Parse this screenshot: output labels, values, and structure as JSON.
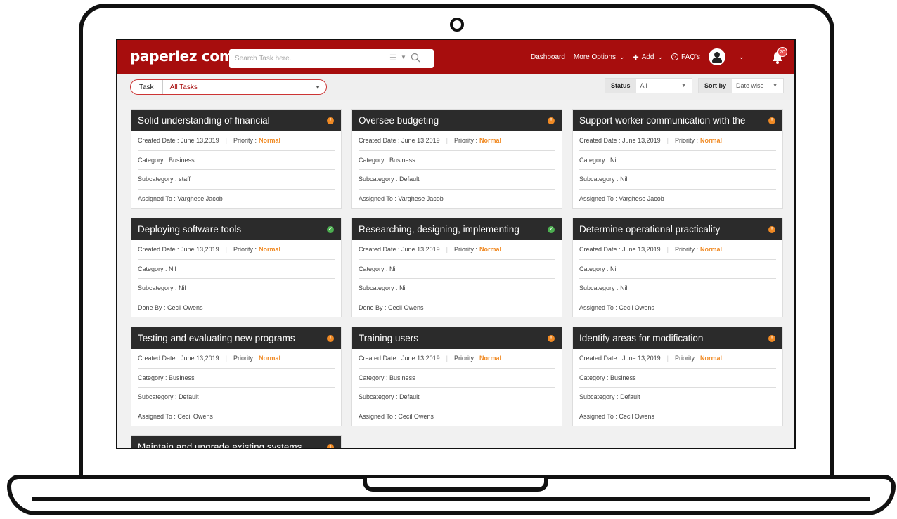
{
  "app": {
    "logo": "paperlez com",
    "search_placeholder": "Search Task here.",
    "nav": {
      "dashboard": "Dashboard",
      "more_options": "More Options",
      "add": "Add",
      "faqs": "FAQ's",
      "notification_count": "20"
    }
  },
  "filters": {
    "task_label": "Task",
    "task_value": "All Tasks",
    "status_label": "Status",
    "status_value": "All",
    "sort_label": "Sort by",
    "sort_value": "Date wise"
  },
  "labels": {
    "created": "Created Date :",
    "priority": "Priority :",
    "category": "Category :",
    "subcategory": "Subcategory :",
    "assigned": "Assigned To :",
    "done": "Done By :"
  },
  "colors": {
    "brand_red": "#a70d0d",
    "card_header": "#2b2b2b",
    "priority_orange": "#f08a24",
    "status_pending": "#f08a24",
    "status_done": "#4caf50"
  },
  "cards": [
    {
      "title": "Solid understanding of financial",
      "status": "pending",
      "date": "June 13,2019",
      "priority": "Normal",
      "category": "Business",
      "subcategory": "staff",
      "person_label": "Assigned To :",
      "person": "Varghese Jacob"
    },
    {
      "title": "Oversee budgeting",
      "status": "pending",
      "date": "June 13,2019",
      "priority": "Normal",
      "category": "Business",
      "subcategory": "Default",
      "person_label": "Assigned To :",
      "person": "Varghese Jacob"
    },
    {
      "title": "Support worker communication with the",
      "status": "pending",
      "date": "June 13,2019",
      "priority": "Normal",
      "category": "Nil",
      "subcategory": "Nil",
      "person_label": "Assigned To :",
      "person": "Varghese Jacob"
    },
    {
      "title": "Deploying software tools",
      "status": "done",
      "date": "June 13,2019",
      "priority": "Normal",
      "category": "Nil",
      "subcategory": "Nil",
      "person_label": "Done By :",
      "person": "Cecil Owens"
    },
    {
      "title": "Researching, designing, implementing",
      "status": "done",
      "date": "June 13,2019",
      "priority": "Normal",
      "category": "Nil",
      "subcategory": "Nil",
      "person_label": "Done By :",
      "person": "Cecil Owens"
    },
    {
      "title": "Determine operational practicality",
      "status": "pending",
      "date": "June 13,2019",
      "priority": "Normal",
      "category": "Nil",
      "subcategory": "Nil",
      "person_label": "Assigned To :",
      "person": "Cecil Owens"
    },
    {
      "title": "Testing and evaluating new programs",
      "status": "pending",
      "date": "June 13,2019",
      "priority": "Normal",
      "category": "Business",
      "subcategory": "Default",
      "person_label": "Assigned To :",
      "person": "Cecil Owens"
    },
    {
      "title": "Training users",
      "status": "pending",
      "date": "June 13,2019",
      "priority": "Normal",
      "category": "Business",
      "subcategory": "Default",
      "person_label": "Assigned To :",
      "person": "Cecil Owens"
    },
    {
      "title": "Identify areas for modification",
      "status": "pending",
      "date": "June 13,2019",
      "priority": "Normal",
      "category": "Business",
      "subcategory": "Default",
      "person_label": "Assigned To :",
      "person": "Cecil Owens"
    },
    {
      "title": "Maintain and upgrade existing systems",
      "status": "pending",
      "date": "",
      "priority": "",
      "category": "",
      "subcategory": "",
      "person_label": "",
      "person": ""
    }
  ]
}
